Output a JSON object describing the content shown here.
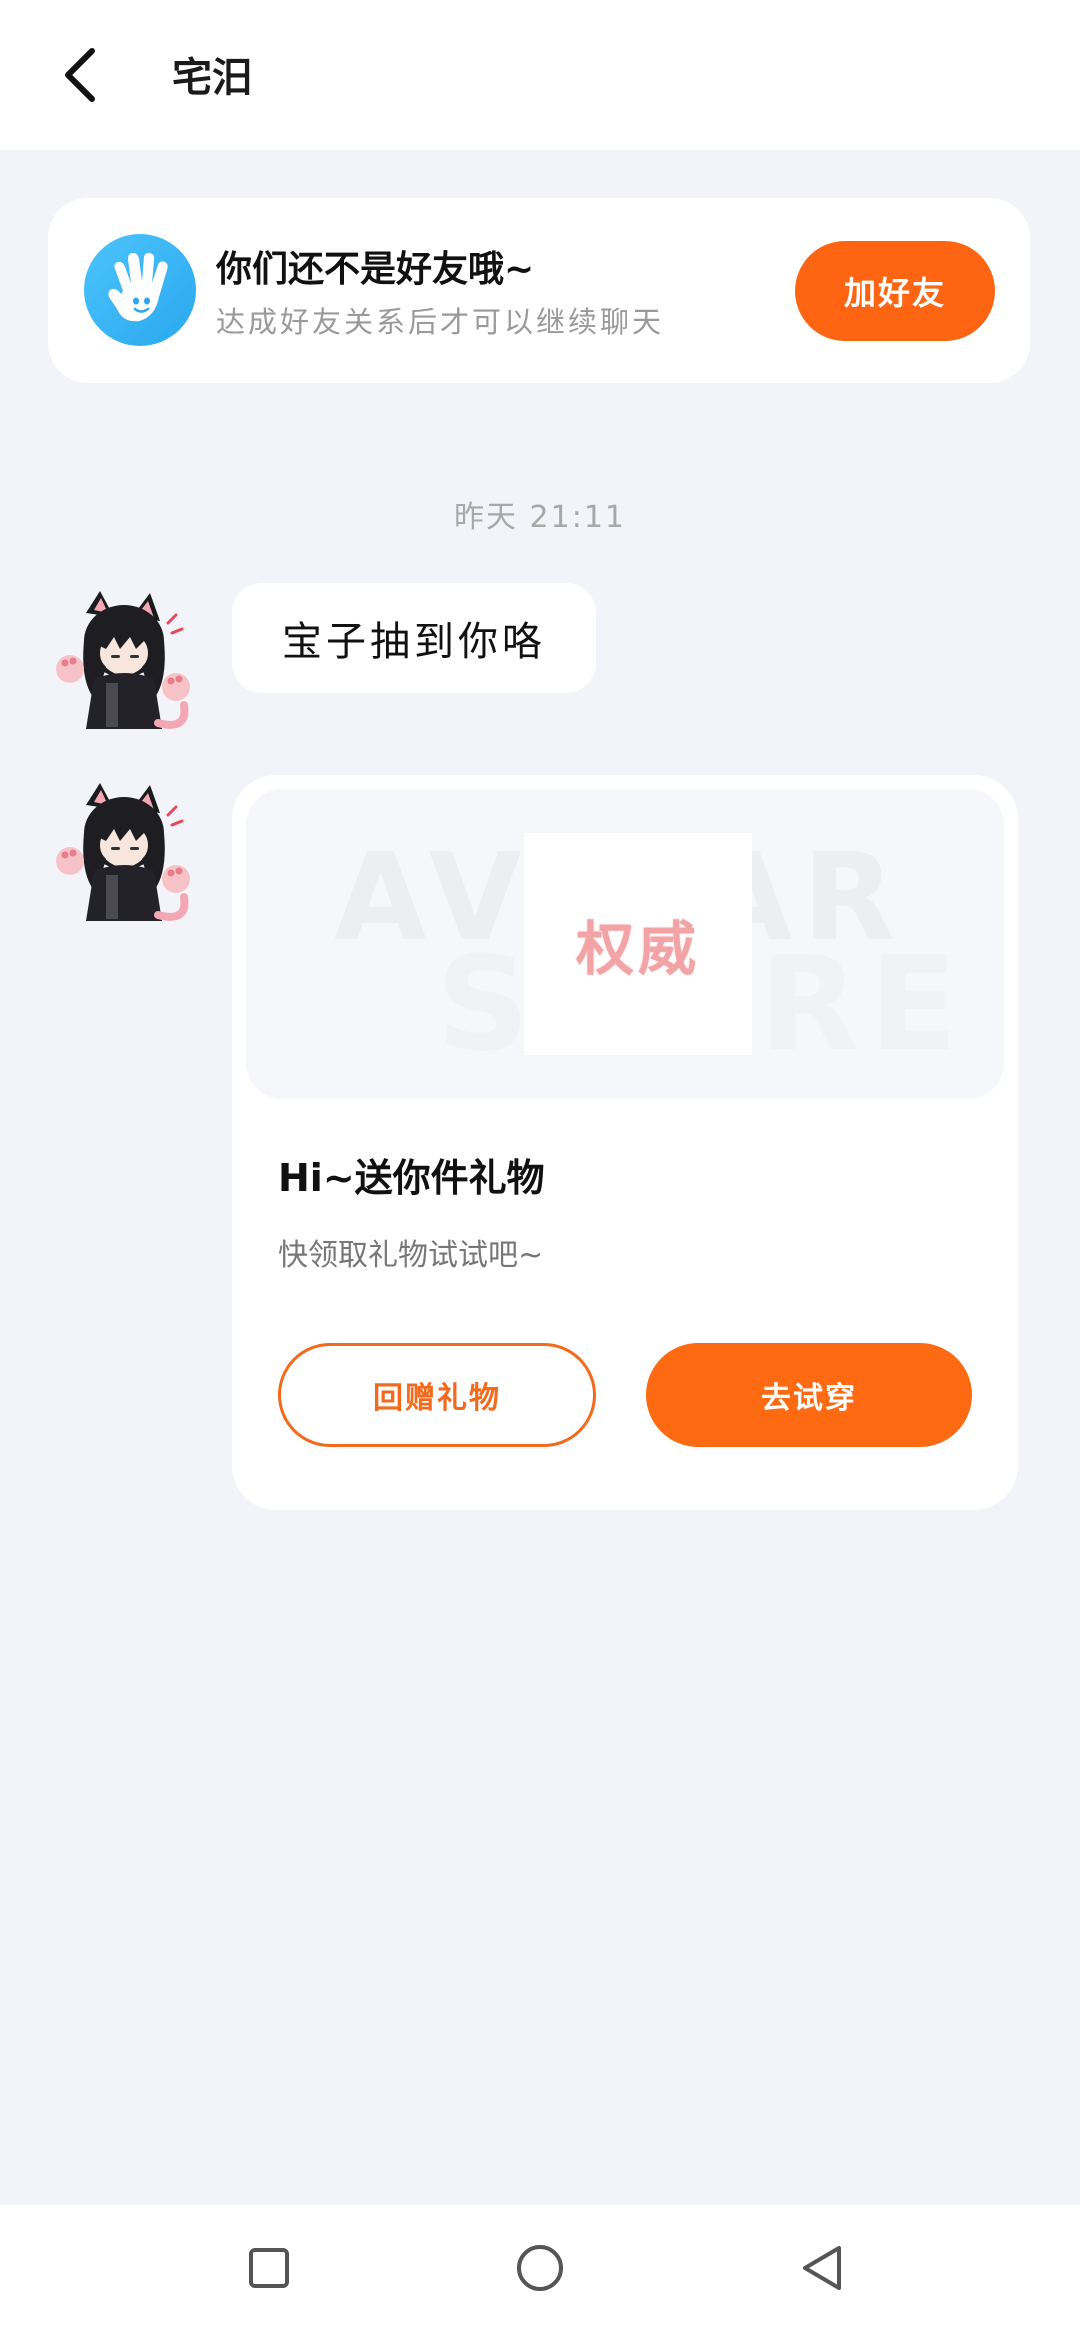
{
  "header": {
    "title": "宅汨",
    "back_icon": "chevron-left-icon"
  },
  "friend_banner": {
    "icon": "waving-hand-icon",
    "title": "你们还不是好友哦~",
    "subtitle": "达成好友关系后才可以继续聊天",
    "add_button_label": "加好友",
    "accent_color": "#fe6512"
  },
  "chat": {
    "timestamp": "昨天 21:11",
    "messages": [
      {
        "type": "text",
        "sender_avatar": "black-cat-girl-avatar",
        "text": "宝子抽到你咯"
      },
      {
        "type": "gift-card",
        "sender_avatar": "black-cat-girl-avatar",
        "preview": {
          "watermark_line1": "AVATAR",
          "watermark_line2": "STORE",
          "gift_tag": "权威"
        },
        "title": "Hi~送你件礼物",
        "subtitle": "快领取礼物试试吧~",
        "return_gift_label": "回赠礼物",
        "try_on_label": "去试穿"
      }
    ]
  },
  "system_nav": {
    "recent_icon": "square-icon",
    "home_icon": "circle-icon",
    "back_icon": "triangle-back-icon"
  }
}
